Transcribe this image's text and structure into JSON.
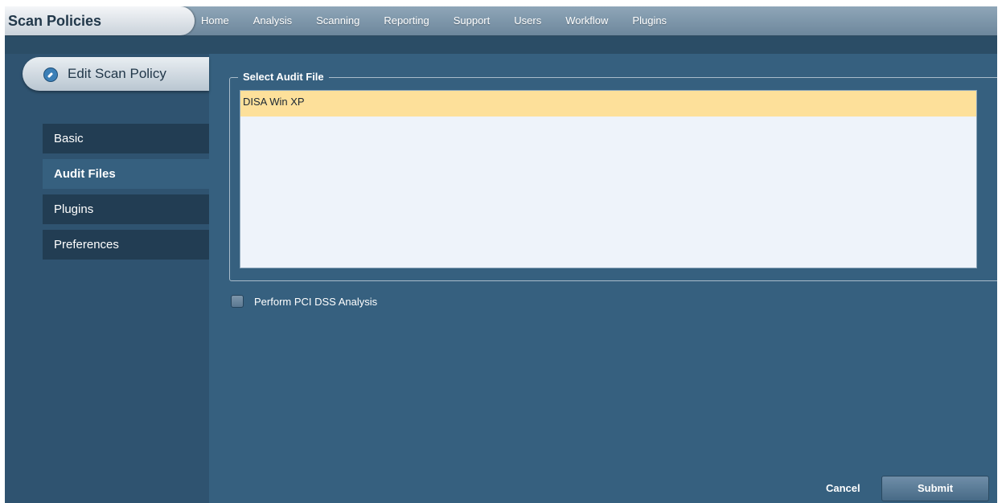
{
  "app": {
    "title": "Scan Policies"
  },
  "nav": {
    "items": [
      {
        "label": "Home"
      },
      {
        "label": "Analysis"
      },
      {
        "label": "Scanning"
      },
      {
        "label": "Reporting"
      },
      {
        "label": "Support"
      },
      {
        "label": "Users"
      },
      {
        "label": "Workflow"
      },
      {
        "label": "Plugins"
      }
    ]
  },
  "sidebar": {
    "header_label": "Edit Scan Policy",
    "header_icon": "edit-icon",
    "items": [
      {
        "label": "Basic",
        "active": false
      },
      {
        "label": "Audit Files",
        "active": true
      },
      {
        "label": "Plugins",
        "active": false
      },
      {
        "label": "Preferences",
        "active": false
      }
    ]
  },
  "main": {
    "legend": "Select Audit File",
    "audit_files": [
      {
        "label": "DISA Win XP",
        "selected": true
      }
    ],
    "pci_label": "Perform PCI DSS Analysis",
    "pci_checked": false
  },
  "actions": {
    "cancel_label": "Cancel",
    "submit_label": "Submit"
  },
  "colors": {
    "background": "#36607f",
    "selected_row": "#fde09a"
  }
}
